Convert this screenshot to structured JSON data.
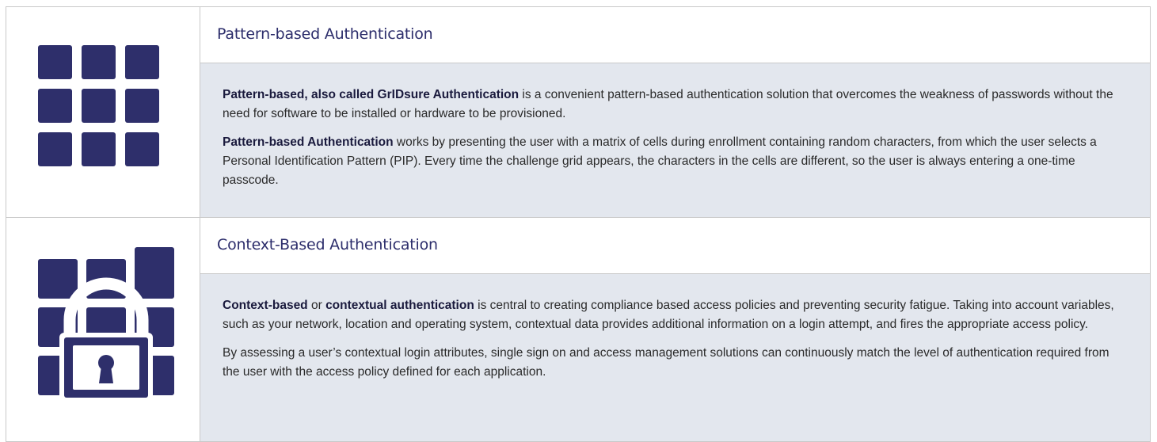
{
  "sections": [
    {
      "title": "Pattern-based Authentication",
      "icon": "grid-icon",
      "paragraphs": [
        {
          "bold": "Pattern-based, also called GrIDsure Authentication",
          "text": " is a convenient pattern-based authentication solution that overcomes the weakness of passwords without the need for software to be installed or hardware to be provisioned."
        },
        {
          "bold": "Pattern-based Authentication",
          "text": " works by presenting the user with a matrix of cells during enrollment containing random characters, from which the user selects a Personal Identification Pattern (PIP). Every time the challenge grid appears, the characters in the cells are different, so the user is always entering a one-time passcode."
        }
      ]
    },
    {
      "title": "Context-Based Authentication",
      "icon": "padlock-grid-icon",
      "paragraphs": [
        {
          "bold": "Context-based",
          "mid": " or ",
          "bold2": "contextual authentication",
          "text": " is central to creating compliance based access policies and preventing security fatigue. Taking into account variables, such as your network, location and operating system, contextual data provides additional information on a login attempt, and fires the appropriate access policy."
        },
        {
          "text": "By assessing a user’s contextual login attributes, single sign on and access management solutions can continuously match the level of authentication required from the user with the access policy defined for each application."
        }
      ]
    }
  ],
  "colors": {
    "icon": "#2e2f6b",
    "title": "#2c2d6b",
    "body_bg": "#e3e7ee",
    "border": "#c9c9c9"
  }
}
